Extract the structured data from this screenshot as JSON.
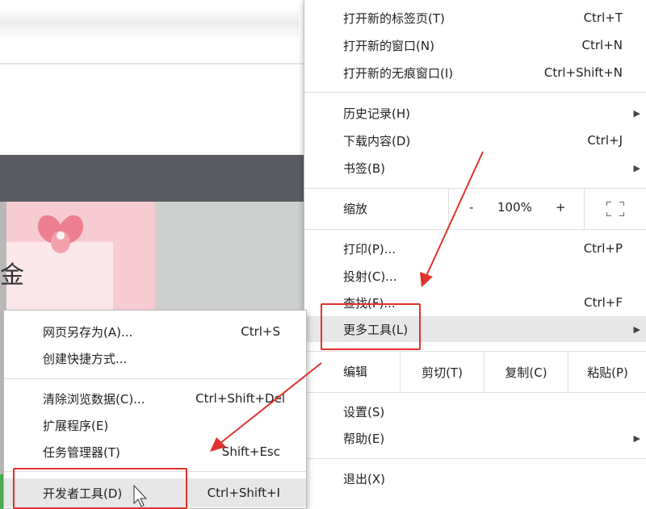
{
  "main_menu": {
    "new_tab": {
      "label": "打开新的标签页(T)",
      "shortcut": "Ctrl+T"
    },
    "new_window": {
      "label": "打开新的窗口(N)",
      "shortcut": "Ctrl+N"
    },
    "incognito": {
      "label": "打开新的无痕窗口(I)",
      "shortcut": "Ctrl+Shift+N"
    },
    "history": {
      "label": "历史记录(H)"
    },
    "downloads": {
      "label": "下载内容(D)",
      "shortcut": "Ctrl+J"
    },
    "bookmarks": {
      "label": "书签(B)"
    },
    "zoom": {
      "label": "缩放",
      "minus": "-",
      "value": "100%",
      "plus": "+"
    },
    "print": {
      "label": "打印(P)...",
      "shortcut": "Ctrl+P"
    },
    "cast": {
      "label": "投射(C)..."
    },
    "find": {
      "label": "查找(F)...",
      "shortcut": "Ctrl+F"
    },
    "more_tools": {
      "label": "更多工具(L)"
    },
    "edit": {
      "label": "编辑",
      "cut": "剪切(T)",
      "copy": "复制(C)",
      "paste": "粘贴(P)"
    },
    "settings": {
      "label": "设置(S)"
    },
    "help": {
      "label": "帮助(E)"
    },
    "exit": {
      "label": "退出(X)"
    }
  },
  "sub_menu": {
    "save_page": {
      "label": "网页另存为(A)...",
      "shortcut": "Ctrl+S"
    },
    "create_shortcut": {
      "label": "创建快捷方式..."
    },
    "clear_data": {
      "label": "清除浏览数据(C)...",
      "shortcut": "Ctrl+Shift+Del"
    },
    "extensions": {
      "label": "扩展程序(E)"
    },
    "task_manager": {
      "label": "任务管理器(T)",
      "shortcut": "Shift+Esc"
    },
    "dev_tools": {
      "label": "开发者工具(D)",
      "shortcut": "Ctrl+Shift+I"
    }
  },
  "background": {
    "partial_char": "金"
  },
  "colors": {
    "annotation_red": "#e0322d",
    "highlight": "#e7e7e7",
    "dark_bar": "#5a5c62",
    "pink_panel": "#f6ccd2"
  }
}
